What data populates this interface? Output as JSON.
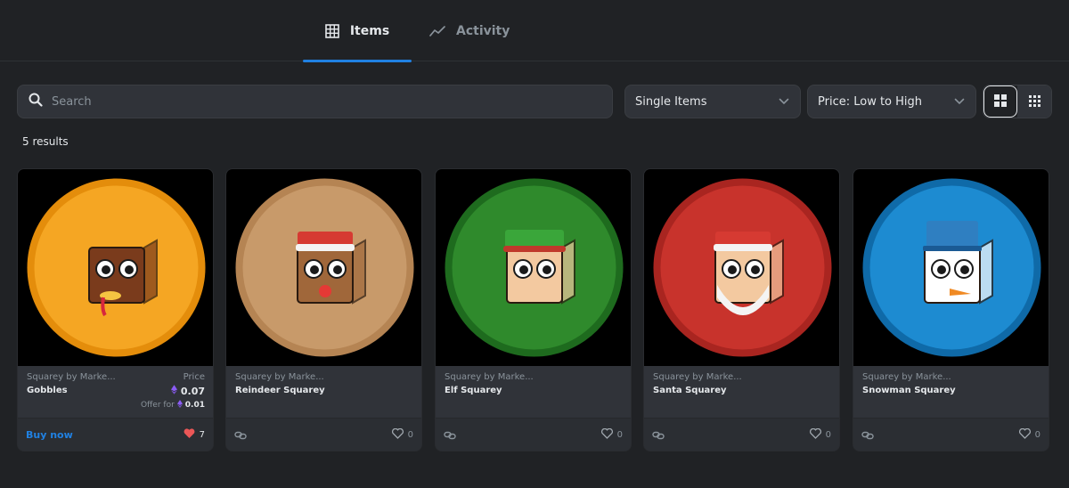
{
  "tabs": [
    {
      "label": "Items",
      "icon": "grid-icon",
      "active": true
    },
    {
      "label": "Activity",
      "icon": "chart-line-icon",
      "active": false
    }
  ],
  "search": {
    "placeholder": "Search",
    "value": ""
  },
  "filters": {
    "type_select": "Single Items",
    "sort_select": "Price: Low to High"
  },
  "view_toggle": {
    "large_grid_icon": "large-grid-icon",
    "small_grid_icon": "small-grid-icon",
    "active": "large"
  },
  "results_label": "5 results",
  "colors": {
    "accent": "#2081e2",
    "background": "#202225",
    "card": "#303339",
    "heart": "#eb5757",
    "eth": "#8b5cf6"
  },
  "cards": [
    {
      "collection": "Squarey by Marke...",
      "name": "Gobbles",
      "price_label": "Price",
      "price": "0.07",
      "offer_label": "Offer for",
      "offer": "0.01",
      "action": "Buy now",
      "likes": "7",
      "liked": true,
      "theme": "turkey",
      "bg": "#f5a623",
      "ring": "#e48d0b"
    },
    {
      "collection": "Squarey by Marke...",
      "name": "Reindeer Squarey",
      "likes": "0",
      "liked": false,
      "theme": "reindeer",
      "bg": "#c89a6a",
      "ring": "#b58453"
    },
    {
      "collection": "Squarey by Marke...",
      "name": "Elf Squarey",
      "likes": "0",
      "liked": false,
      "theme": "elf",
      "bg": "#2f8a2c",
      "ring": "#1e6b1e"
    },
    {
      "collection": "Squarey by Marke...",
      "name": "Santa Squarey",
      "likes": "0",
      "liked": false,
      "theme": "santa",
      "bg": "#c8332c",
      "ring": "#a92520"
    },
    {
      "collection": "Squarey by Marke...",
      "name": "Snowman Squarey",
      "likes": "0",
      "liked": false,
      "theme": "snowman",
      "bg": "#1d8bd1",
      "ring": "#0f6aa8"
    }
  ]
}
